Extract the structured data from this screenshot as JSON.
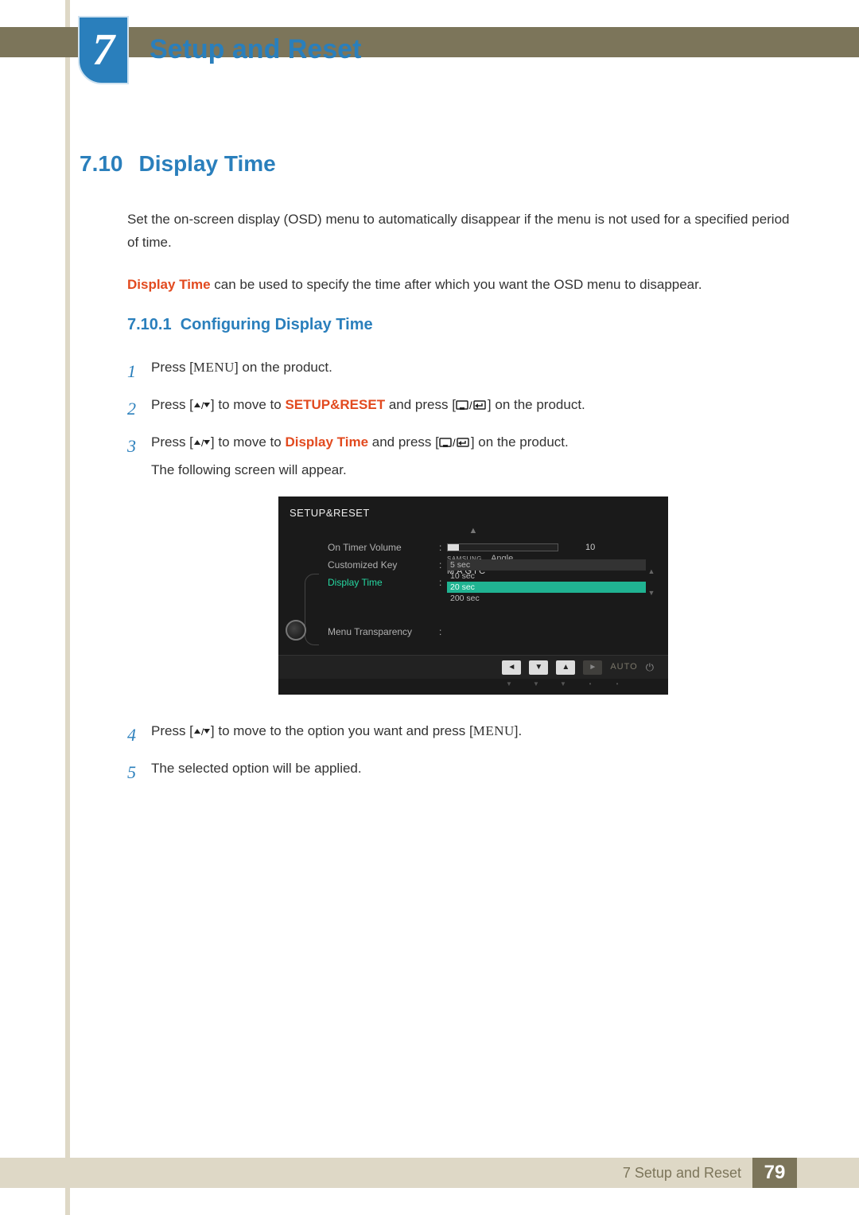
{
  "chapter": {
    "number": "7",
    "title": "Setup and Reset"
  },
  "section": {
    "number": "7.10",
    "title": "Display Time"
  },
  "intro": {
    "p1": "Set the on-screen display (OSD) menu to automatically disappear if the menu is not used for a specified period of time.",
    "p2_a": "Display Time",
    "p2_b": " can be used to specify the time after which you want the OSD menu to disappear."
  },
  "subsection": {
    "number": "7.10.1",
    "title": "Configuring Display Time"
  },
  "steps": {
    "s1": {
      "num": "1",
      "a": "Press [",
      "menu": "MENU",
      "b": "] on the product."
    },
    "s2": {
      "num": "2",
      "a": "Press [",
      "b": "] to move to ",
      "kw": "SETUP&RESET",
      "c": " and press [",
      "d": "] on the product."
    },
    "s3": {
      "num": "3",
      "a": "Press [",
      "b": "] to move to ",
      "kw": "Display Time",
      "c": " and press [",
      "d": "] on the product.",
      "e": "The following screen will appear."
    },
    "s4": {
      "num": "4",
      "a": "Press [",
      "b": "] to move to the option you want and press [",
      "menu": "MENU",
      "c": "]."
    },
    "s5": {
      "num": "5",
      "a": "The selected option will be applied."
    }
  },
  "osd": {
    "title": "SETUP&RESET",
    "rows": {
      "volume": {
        "label": "On Timer  Volume",
        "value": "10"
      },
      "ckey": {
        "label": "Customized Key",
        "magic_sup": "SAMSUNG",
        "magic": "MAGIC",
        "suffix": " Angle"
      },
      "dtime": {
        "label": "Display Time"
      },
      "mtrans": {
        "label": "Menu Transparency"
      }
    },
    "options": {
      "o1": "5 sec",
      "o2": "10 sec",
      "o3": "20 sec",
      "o4": "200 sec"
    },
    "nav": {
      "auto": "AUTO"
    }
  },
  "footer": {
    "label": "7 Setup and Reset",
    "page": "79"
  }
}
